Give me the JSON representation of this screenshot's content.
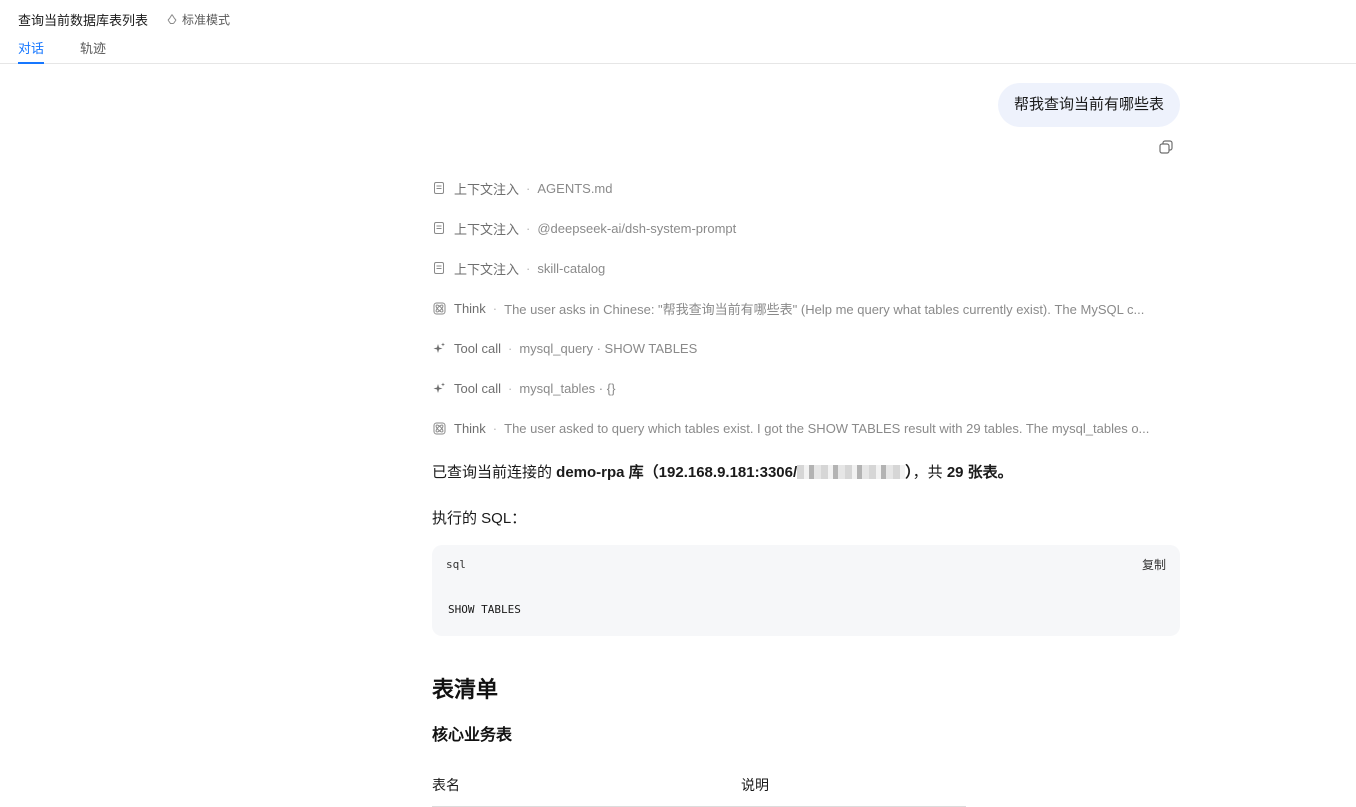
{
  "header": {
    "title": "查询当前数据库表列表",
    "mode": "标准模式",
    "tabs": [
      {
        "label": "对话",
        "active": true
      },
      {
        "label": "轨迹",
        "active": false
      }
    ]
  },
  "chat": {
    "user_message": "帮我查询当前有哪些表",
    "steps": [
      {
        "icon": "document-icon",
        "kind": "上下文注入",
        "detail": "AGENTS.md"
      },
      {
        "icon": "document-icon",
        "kind": "上下文注入",
        "detail": "@deepseek-ai/dsh-system-prompt"
      },
      {
        "icon": "document-icon",
        "kind": "上下文注入",
        "detail": "skill-catalog"
      },
      {
        "icon": "brain-icon",
        "kind": "Think",
        "detail": "The user asks in Chinese: \"帮我查询当前有哪些表\" (Help me query what tables currently exist). The MySQL c..."
      },
      {
        "icon": "sparkle-icon",
        "kind": "Tool call",
        "detail": "mysql_query · SHOW TABLES"
      },
      {
        "icon": "sparkle-icon",
        "kind": "Tool call",
        "detail": "mysql_tables · {}"
      },
      {
        "icon": "brain-icon",
        "kind": "Think",
        "detail": "The user asked to query which tables exist. I got the SHOW TABLES result with 29 tables. The mysql_tables o..."
      }
    ],
    "separator": "·",
    "summary": {
      "prefix": "已查询当前连接的 ",
      "db": "demo-rpa 库（192.168.9.181:3306/",
      "close": "）",
      "middle": "，共 ",
      "count": "29 张表。"
    },
    "sql_label": "执行的 SQL：",
    "code": {
      "lang": "sql",
      "copy_label": "复制",
      "content": "SHOW TABLES"
    },
    "section_title": "表清单",
    "subsection_title": "核心业务表",
    "table_headers": [
      "表名",
      "说明"
    ]
  },
  "colors": {
    "accent": "#1677ff",
    "bubble_bg": "#eef2fc",
    "code_bg": "#f6f7f9"
  }
}
